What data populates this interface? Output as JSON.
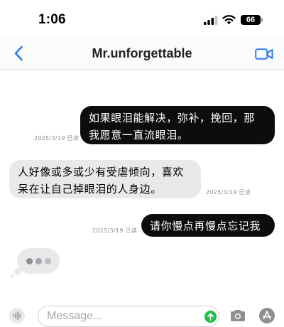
{
  "status_bar": {
    "time": "1:06",
    "battery": "66",
    "icons": [
      "signal-icon",
      "wifi-icon",
      "battery-icon"
    ]
  },
  "nav": {
    "title": "Mr.unforgettable",
    "back_icon": "chevron-left-icon",
    "video_icon": "video-camera-icon",
    "accent_color": "#2a7cf6"
  },
  "messages": [
    {
      "direction": "outgoing",
      "text": "如果眼泪能解决，弥补，挽回，那\n我愿意一直流眼泪。",
      "stamp": "2025/3/19 已读"
    },
    {
      "direction": "incoming",
      "text": "人好像或多或少有受虐倾向，喜欢\n呆在让自己掉眼泪的人身边。",
      "stamp": "2025/3/19 已读"
    },
    {
      "direction": "outgoing",
      "text": "请你慢点再慢点忘记我",
      "stamp": "2025/3/19 已读"
    }
  ],
  "typing_indicator": {
    "visible": true
  },
  "input_bar": {
    "placeholder": "Message...",
    "send_color": "#1fbf4a",
    "icons": [
      "microphone-waveform-icon",
      "send-arrow-icon",
      "camera-icon",
      "app-store-icon"
    ]
  }
}
